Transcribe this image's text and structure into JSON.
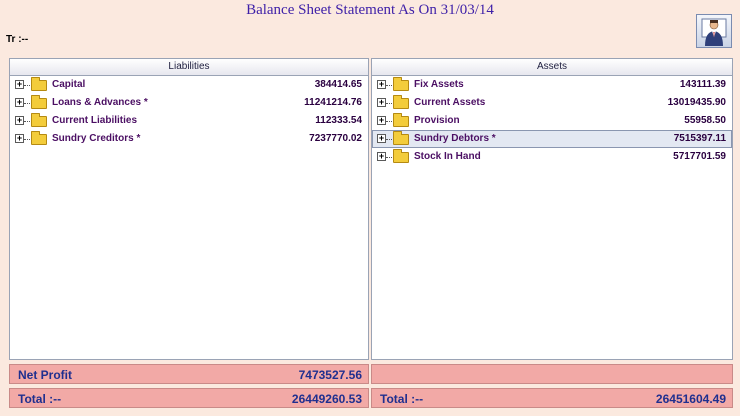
{
  "header": {
    "title": "Balance Sheet Statement As On 31/03/14",
    "tr_label": "Tr :--"
  },
  "liabilities": {
    "header": "Liabilities",
    "items": [
      {
        "label": "Capital",
        "amount": "384414.65"
      },
      {
        "label": "Loans & Advances *",
        "amount": "11241214.76"
      },
      {
        "label": "Current Liabilities",
        "amount": "112333.54"
      },
      {
        "label": "Sundry Creditors *",
        "amount": "7237770.02"
      }
    ]
  },
  "assets": {
    "header": "Assets",
    "items": [
      {
        "label": "Fix Assets",
        "amount": "143111.39"
      },
      {
        "label": "Current Assets",
        "amount": "13019435.90"
      },
      {
        "label": "Provision",
        "amount": "55958.50"
      },
      {
        "label": "Sundry Debtors *",
        "amount": "7515397.11"
      },
      {
        "label": "Stock In Hand",
        "amount": "5717701.59"
      }
    ]
  },
  "net_profit": {
    "label": "Net Profit",
    "amount": "7473527.56"
  },
  "totals": {
    "left_label": "Total :--",
    "left_amount": "26449260.53",
    "right_label": "Total :--",
    "right_amount": "26451604.49"
  },
  "colors": {
    "title": "#3d1fa8",
    "item_text": "#4b0f63",
    "total_bar": "#f2a9a6",
    "background": "#fbe9df"
  }
}
